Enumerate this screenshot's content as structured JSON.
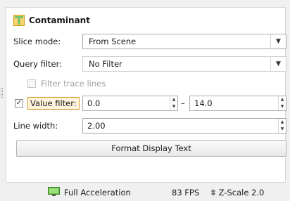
{
  "panel": {
    "title": "Contaminant",
    "slice_mode": {
      "label": "Slice mode:",
      "value": "From Scene"
    },
    "query_filter": {
      "label": "Query filter:",
      "value": "No Filter"
    },
    "trace_lines": {
      "label": "Filter trace lines",
      "checked": false,
      "enabled": false
    },
    "value_filter": {
      "label": "Value filter:",
      "checked": true,
      "min": "0.0",
      "dash": "–",
      "max": "14.0"
    },
    "line_width": {
      "label": "Line width:",
      "value": "2.00"
    },
    "format_button": "Format Display Text"
  },
  "status_bar": {
    "acceleration": "Full Acceleration",
    "fps": "83 FPS",
    "zscale": "Z-Scale 2.0"
  },
  "icons": {
    "header": "layer-icon",
    "dropdown": "chevron-down-icon",
    "monitor": "monitor-icon",
    "zscale": "vertical-arrows-icon"
  },
  "colors": {
    "highlight_border": "#d99a2b",
    "highlight_fill": "#fff4dc"
  }
}
